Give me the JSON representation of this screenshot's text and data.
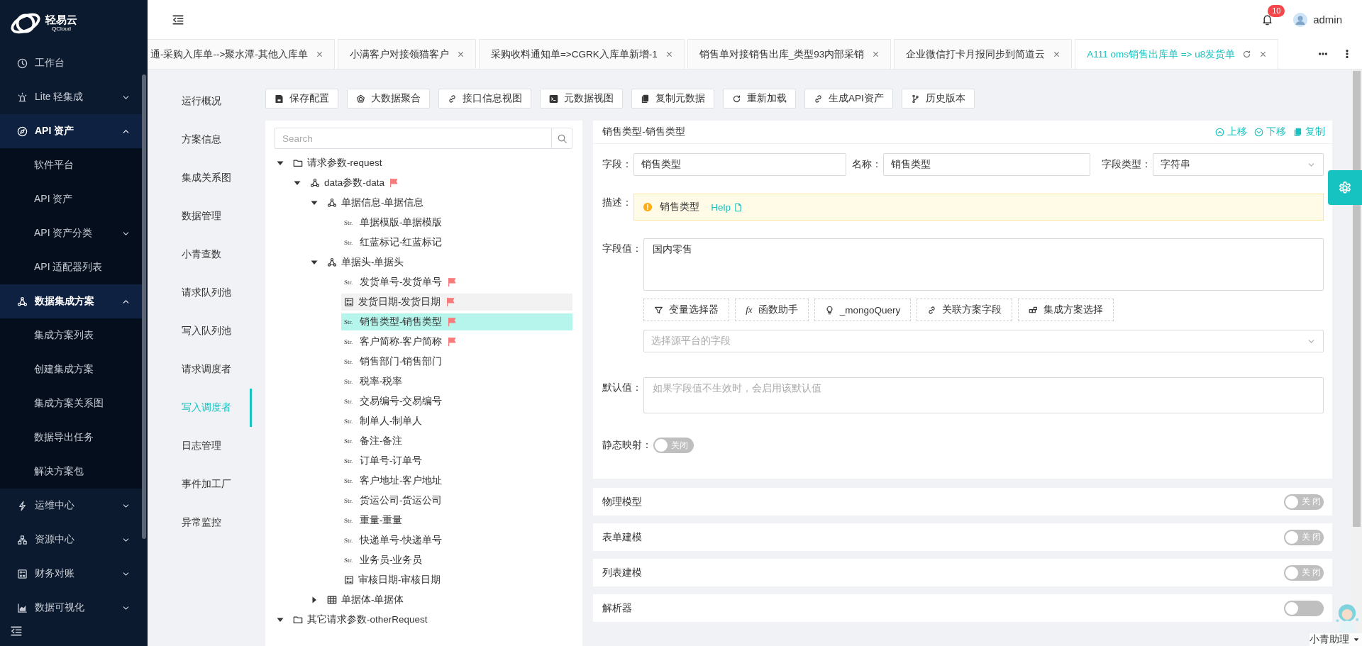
{
  "sidebar": {
    "logo_text": "轻易云",
    "logo_subtext": "QCloud",
    "items": [
      {
        "label": "工作台"
      },
      {
        "label": "Lite 轻集成",
        "expanded": false
      },
      {
        "label": "API 资产",
        "expanded": true,
        "children": [
          {
            "label": "软件平台"
          },
          {
            "label": "API 资产"
          },
          {
            "label": "API 资产分类",
            "expanded": false
          },
          {
            "label": "API 适配器列表"
          }
        ]
      },
      {
        "label": "数据集成方案",
        "expanded": true,
        "children": [
          {
            "label": "集成方案列表"
          },
          {
            "label": "创建集成方案"
          },
          {
            "label": "集成方案关系图"
          },
          {
            "label": "数据导出任务"
          },
          {
            "label": "解决方案包"
          }
        ]
      },
      {
        "label": "运维中心",
        "expanded": false
      },
      {
        "label": "资源中心",
        "expanded": false
      },
      {
        "label": "财务对账",
        "expanded": false
      },
      {
        "label": "数据可视化",
        "expanded": false
      }
    ]
  },
  "header": {
    "notification_count": "10",
    "user": "admin"
  },
  "tabs": [
    {
      "label": "通-采购入库单-->聚水潭-其他入库单",
      "selected": false
    },
    {
      "label": "小满客户对接领猫客户",
      "selected": false
    },
    {
      "label": "采购收料通知单=>CGRK入库单新增-1",
      "selected": false
    },
    {
      "label": "销售单对接销售出库_类型93内部采销",
      "selected": false
    },
    {
      "label": "企业微信打卡月报同步到简道云",
      "selected": false
    },
    {
      "label": "A111 oms销售出库单 => u8发货单",
      "selected": true
    }
  ],
  "side_nav": [
    {
      "label": "运行概况",
      "selected": false
    },
    {
      "label": "方案信息",
      "selected": false
    },
    {
      "label": "集成关系图",
      "selected": false
    },
    {
      "label": "数据管理",
      "selected": false
    },
    {
      "label": "小青查数",
      "selected": false
    },
    {
      "label": "请求队列池",
      "selected": false
    },
    {
      "label": "写入队列池",
      "selected": false
    },
    {
      "label": "请求调度者",
      "selected": false
    },
    {
      "label": "写入调度者",
      "selected": true
    },
    {
      "label": "日志管理",
      "selected": false
    },
    {
      "label": "事件加工厂",
      "selected": false
    },
    {
      "label": "异常监控",
      "selected": false
    }
  ],
  "toolbar": [
    "保存配置",
    "大数据聚合",
    "接口信息视图",
    "元数据视图",
    "复制元数据",
    "重新加载",
    "生成API资产",
    "历史版本"
  ],
  "tree": {
    "search_placeholder": "Search",
    "nodes": [
      {
        "label": "请求参数-request",
        "kind": "folder",
        "expanded": true,
        "flagged": false,
        "children": [
          {
            "label": "data参数-data",
            "kind": "object",
            "expanded": true,
            "flagged": true,
            "children": [
              {
                "label": "单据信息-单据信息",
                "kind": "object",
                "expanded": true,
                "flagged": false,
                "children": [
                  {
                    "label": "单据模版-单据模版",
                    "kind": "string",
                    "type_label": "Str.",
                    "flagged": false,
                    "selected": false,
                    "hovered": false
                  },
                  {
                    "label": "红蓝标记-红蓝标记",
                    "kind": "string",
                    "type_label": "Str.",
                    "flagged": false,
                    "selected": false,
                    "hovered": false
                  }
                ]
              },
              {
                "label": "单据头-单据头",
                "kind": "object",
                "expanded": true,
                "flagged": false,
                "children": [
                  {
                    "label": "发货单号-发货单号",
                    "kind": "string",
                    "type_label": "Str.",
                    "flagged": true,
                    "selected": false,
                    "hovered": false
                  },
                  {
                    "label": "发货日期-发货日期",
                    "kind": "date",
                    "flagged": true,
                    "selected": false,
                    "hovered": true
                  },
                  {
                    "label": "销售类型-销售类型",
                    "kind": "string",
                    "type_label": "Str.",
                    "flagged": true,
                    "selected": true,
                    "hovered": false
                  },
                  {
                    "label": "客户简称-客户简称",
                    "kind": "string",
                    "type_label": "Str.",
                    "flagged": true,
                    "selected": false,
                    "hovered": false
                  },
                  {
                    "label": "销售部门-销售部门",
                    "kind": "string",
                    "type_label": "Str.",
                    "flagged": false,
                    "selected": false,
                    "hovered": false
                  },
                  {
                    "label": "税率-税率",
                    "kind": "string",
                    "type_label": "Str.",
                    "flagged": false,
                    "selected": false,
                    "hovered": false
                  },
                  {
                    "label": "交易编号-交易编号",
                    "kind": "string",
                    "type_label": "Str.",
                    "flagged": false,
                    "selected": false,
                    "hovered": false
                  },
                  {
                    "label": "制单人-制单人",
                    "kind": "string",
                    "type_label": "Str.",
                    "flagged": false,
                    "selected": false,
                    "hovered": false
                  },
                  {
                    "label": "备注-备注",
                    "kind": "string",
                    "type_label": "Str.",
                    "flagged": false,
                    "selected": false,
                    "hovered": false
                  },
                  {
                    "label": "订单号-订单号",
                    "kind": "string",
                    "type_label": "Str.",
                    "flagged": false,
                    "selected": false,
                    "hovered": false
                  },
                  {
                    "label": "客户地址-客户地址",
                    "kind": "string",
                    "type_label": "Str.",
                    "flagged": false,
                    "selected": false,
                    "hovered": false
                  },
                  {
                    "label": "货运公司-货运公司",
                    "kind": "string",
                    "type_label": "Str.",
                    "flagged": false,
                    "selected": false,
                    "hovered": false
                  },
                  {
                    "label": "重量-重量",
                    "kind": "string",
                    "type_label": "Str.",
                    "flagged": false,
                    "selected": false,
                    "hovered": false
                  },
                  {
                    "label": "快递单号-快递单号",
                    "kind": "string",
                    "type_label": "Str.",
                    "flagged": false,
                    "selected": false,
                    "hovered": false
                  },
                  {
                    "label": "业务员-业务员",
                    "kind": "string",
                    "type_label": "Str.",
                    "flagged": false,
                    "selected": false,
                    "hovered": false
                  },
                  {
                    "label": "审核日期-审核日期",
                    "kind": "date",
                    "flagged": false,
                    "selected": false,
                    "hovered": false
                  }
                ]
              },
              {
                "label": "单据体-单据体",
                "kind": "table",
                "expanded": false,
                "flagged": false
              }
            ]
          }
        ]
      },
      {
        "label": "其它请求参数-otherRequest",
        "kind": "folder",
        "expanded": true,
        "flagged": false
      }
    ]
  },
  "field_card": {
    "title": "销售类型-销售类型",
    "actions": [
      "上移",
      "下移",
      "复制"
    ],
    "field": {
      "label": "字段：",
      "value": "销售类型"
    },
    "name": {
      "label": "名称：",
      "value": "销售类型"
    },
    "type": {
      "label": "字段类型：",
      "value": "字符串"
    },
    "description": {
      "label": "描述：",
      "text": "销售类型",
      "link": "Help"
    },
    "value": {
      "label": "字段值：",
      "value": "国内零售"
    },
    "helpers": [
      {
        "label": "变量选择器"
      },
      {
        "label": "函数助手",
        "icon_text": "fx"
      },
      {
        "label": "_mongoQuery"
      },
      {
        "label": "关联方案字段"
      },
      {
        "label": "集成方案选择"
      }
    ],
    "source_select": {
      "placeholder": "选择源平台的字段"
    },
    "default": {
      "label": "默认值：",
      "placeholder": "如果字段值不生效时，会启用该默认值"
    },
    "static_mapping": {
      "label": "静态映射：",
      "on": false,
      "state_label": "关闭"
    }
  },
  "sections": [
    {
      "label": "物理模型",
      "on": false,
      "state_label": "关闭"
    },
    {
      "label": "表单建模",
      "on": false,
      "state_label": "关闭"
    },
    {
      "label": "列表建模",
      "on": false,
      "state_label": "关闭"
    },
    {
      "label": "解析器",
      "on": false
    }
  ],
  "assistant": {
    "label": "小青助理"
  }
}
